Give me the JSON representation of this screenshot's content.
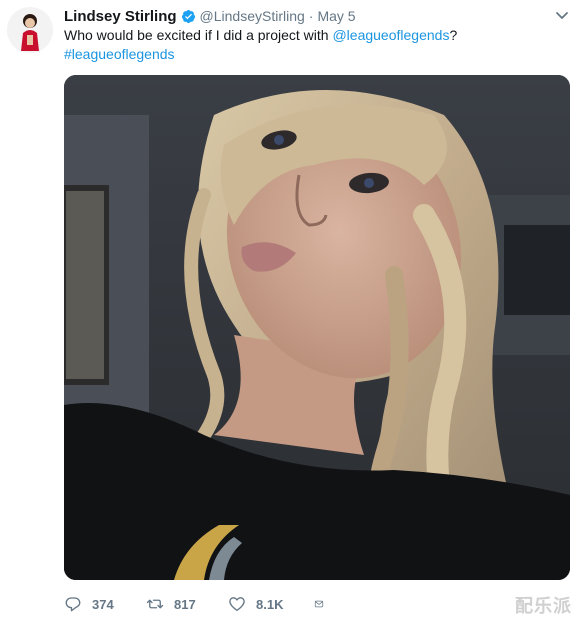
{
  "tweet": {
    "author_name": "Lindsey Stirling",
    "handle": "@LindseyStirling",
    "separator": "·",
    "date": "May 5",
    "text_before": "Who would be excited if I did a project with ",
    "mention": "@leagueoflegends",
    "text_after": "?",
    "hashtag": "#leagueoflegends"
  },
  "actions": {
    "reply_count": "374",
    "retweet_count": "817",
    "like_count": "8.1K"
  },
  "icons": {
    "verified": "verified-badge-icon",
    "caret": "chevron-down-icon",
    "reply": "reply-icon",
    "retweet": "retweet-icon",
    "like": "heart-icon",
    "dm": "envelope-icon"
  },
  "colors": {
    "link": "#1b95e0",
    "muted": "#657786",
    "verified": "#1da1f2"
  },
  "watermark": "配乐派"
}
